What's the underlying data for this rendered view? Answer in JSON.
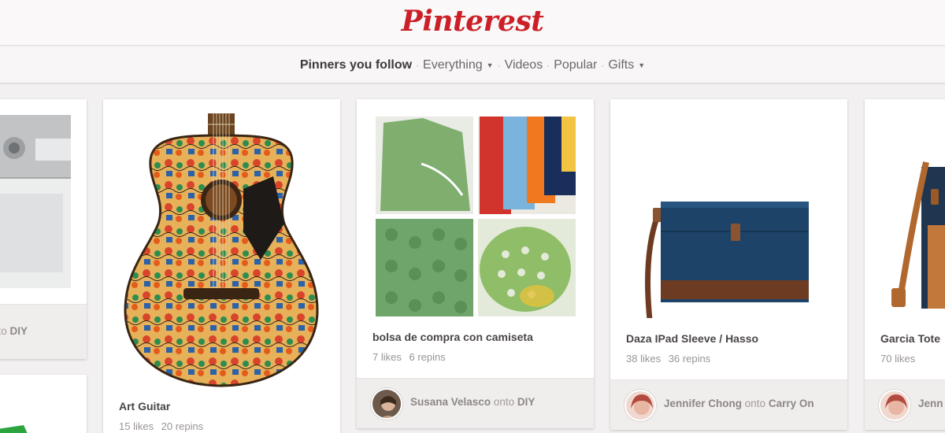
{
  "header": {
    "logo": "Pinterest"
  },
  "nav": {
    "active": "Pinners you follow",
    "everything": "Everything",
    "videos": "Videos",
    "popular": "Popular",
    "gifts": "Gifts",
    "separator": "·"
  },
  "pins": [
    {
      "board": "DIY",
      "attrib_prefix": "nto"
    },
    {
      "description": "Art Guitar",
      "likes": "15 likes",
      "repins": "20 repins"
    },
    {
      "description": "bolsa de compra con camiseta",
      "likes": "7 likes",
      "repins": "6 repins",
      "pinner": "Susana Velasco",
      "onto": "onto",
      "board": "DIY"
    },
    {
      "description": "Daza IPad Sleeve / Hasso",
      "likes": "38 likes",
      "repins": "36 repins",
      "pinner": "Jennifer Chong",
      "onto": "onto",
      "board": "Carry On"
    },
    {
      "description": "Garcia Tote",
      "likes": "70 likes",
      "pinner": "Jenn"
    }
  ],
  "colors": {
    "brand": "#cb2027",
    "background": "#f2f0f0",
    "card": "#ffffff",
    "footer": "#f0eded"
  }
}
